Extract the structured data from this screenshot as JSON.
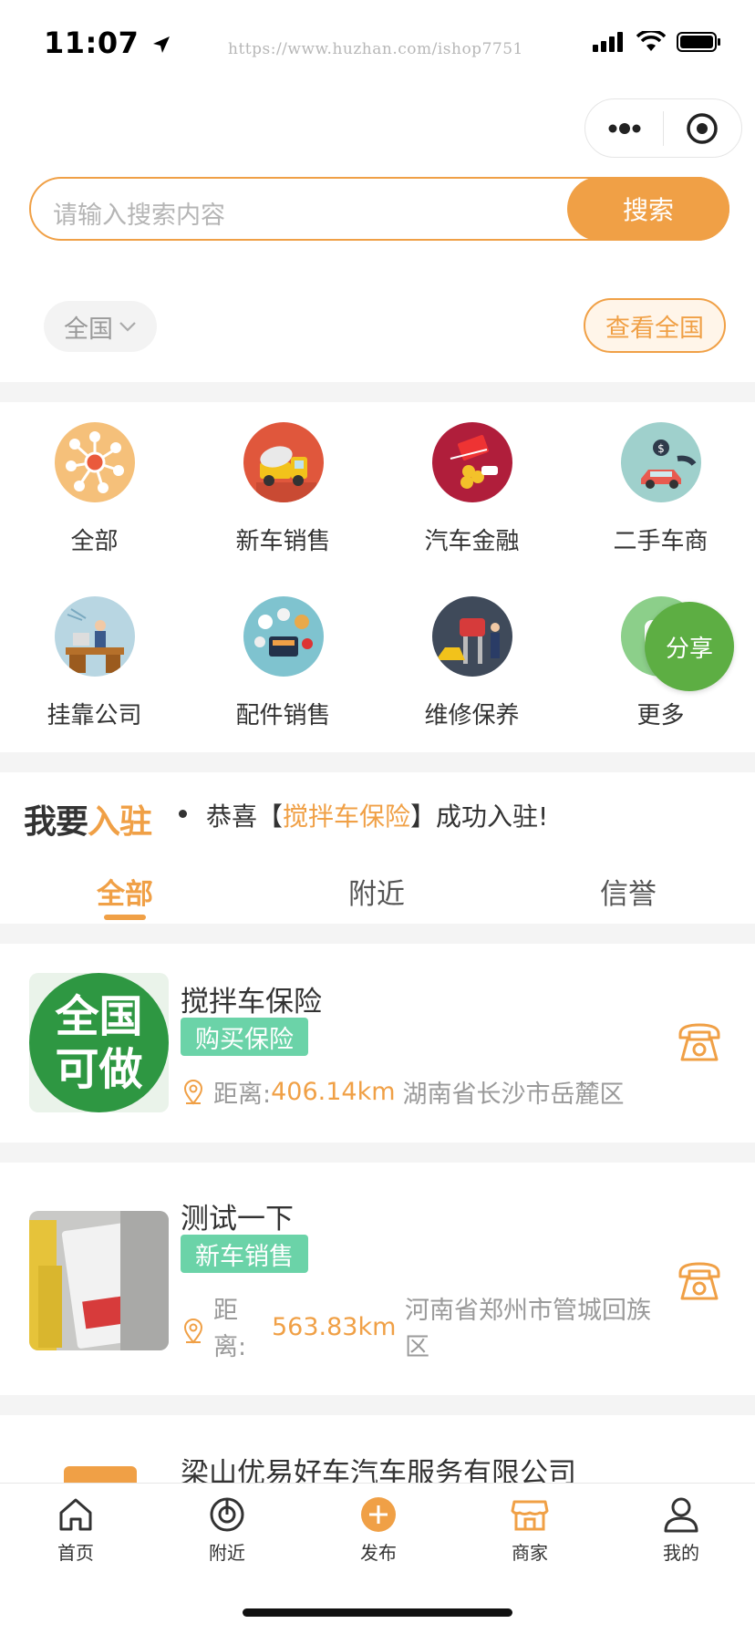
{
  "status_bar": {
    "time": "11:07",
    "watermark": "https://www.huzhan.com/ishop7751"
  },
  "search": {
    "placeholder": "请输入搜索内容",
    "button": "搜索"
  },
  "region": {
    "label": "全国",
    "view_all": "查看全国"
  },
  "categories": [
    {
      "label": "全部",
      "icon": "all-network-icon"
    },
    {
      "label": "新车销售",
      "icon": "mixer-truck-icon"
    },
    {
      "label": "汽车金融",
      "icon": "car-finance-icon"
    },
    {
      "label": "二手车商",
      "icon": "used-car-dealer-icon"
    },
    {
      "label": "挂靠公司",
      "icon": "office-desk-icon"
    },
    {
      "label": "配件销售",
      "icon": "car-parts-icon"
    },
    {
      "label": "维修保养",
      "icon": "car-repair-icon"
    },
    {
      "label": "更多",
      "icon": "more-icon"
    }
  ],
  "share": {
    "label": "分享"
  },
  "join": {
    "logo_a": "我要",
    "logo_b": "入驻",
    "notice_pre": "恭喜【",
    "notice_name": "搅拌车保险",
    "notice_post": "】成功入驻!"
  },
  "tabs": [
    {
      "label": "全部"
    },
    {
      "label": "附近"
    },
    {
      "label": "信誉"
    }
  ],
  "listings": [
    {
      "title": "搅拌车保险",
      "tag": "购买保险",
      "dist_label": "距离:",
      "dist_value": "406.14km",
      "address": "湖南省长沙市岳麓区",
      "image_text_1": "全国",
      "image_text_2": "可做"
    },
    {
      "title": "测试一下",
      "tag": "新车销售",
      "dist_label_1": "距",
      "dist_label_2": "离:",
      "dist_value": "563.83km",
      "address_1": "河南省郑州市管城回族",
      "address_2": "区"
    },
    {
      "title": "梁山优易好车汽车服务有限公司"
    }
  ],
  "tabbar": [
    {
      "label": "首页",
      "icon": "home-icon"
    },
    {
      "label": "附近",
      "icon": "nearby-icon"
    },
    {
      "label": "发布",
      "icon": "publish-plus-icon"
    },
    {
      "label": "商家",
      "icon": "shop-icon"
    },
    {
      "label": "我的",
      "icon": "profile-icon"
    }
  ],
  "colors": {
    "accent": "#f0a046",
    "tag_green": "#6bd3a8",
    "share_green": "#5dae43"
  }
}
